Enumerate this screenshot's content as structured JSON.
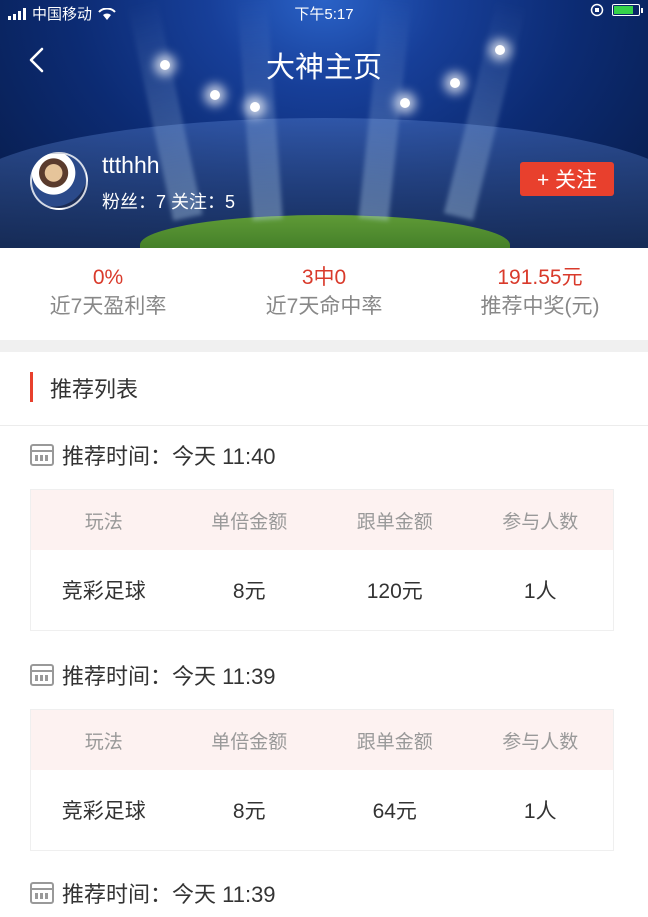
{
  "status_bar": {
    "carrier": "中国移动",
    "time": "下午5:17"
  },
  "header": {
    "title": "大神主页"
  },
  "profile": {
    "username": "ttthhh",
    "fans_text": "粉丝：7 关注：5",
    "follow_label": "+ 关注"
  },
  "stats": [
    {
      "value": "0%",
      "label": "近7天盈利率"
    },
    {
      "value": "3中0",
      "label": "近7天命中率"
    },
    {
      "value": "191.55元",
      "label": "推荐中奖(元)"
    }
  ],
  "section": {
    "title": "推荐列表"
  },
  "columns": [
    "玩法",
    "单倍金额",
    "跟单金额",
    "参与人数"
  ],
  "recommendations": [
    {
      "time_label": "推荐时间：今天 11:40",
      "row": [
        "竞彩足球",
        "8元",
        "120元",
        "1人"
      ]
    },
    {
      "time_label": "推荐时间：今天 11:39",
      "row": [
        "竞彩足球",
        "8元",
        "64元",
        "1人"
      ]
    },
    {
      "time_label": "推荐时间：今天 11:39"
    }
  ],
  "colors": {
    "accent": "#e8402d",
    "stat_value": "#d93a2b",
    "table_header_bg": "#fdf2f1"
  }
}
